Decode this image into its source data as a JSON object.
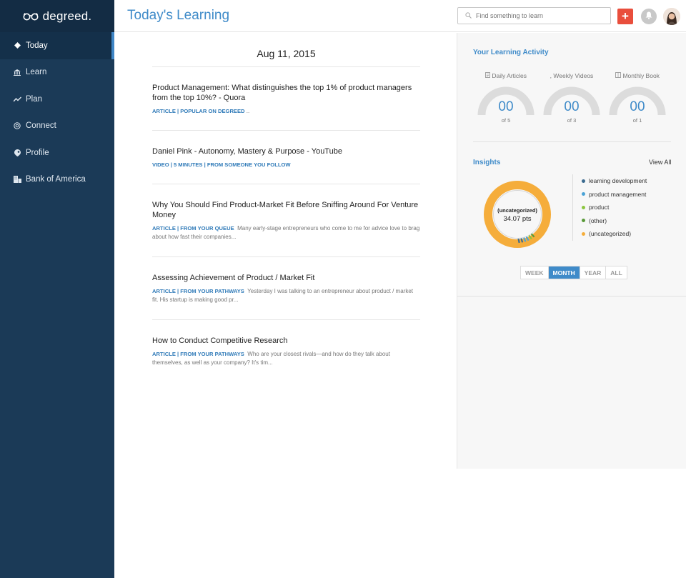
{
  "app": {
    "logo": "degreed."
  },
  "sidebar": {
    "items": [
      {
        "label": "Today",
        "icon": "diamond-icon",
        "active": true
      },
      {
        "label": "Learn",
        "icon": "bank-icon",
        "active": false
      },
      {
        "label": "Plan",
        "icon": "trend-icon",
        "active": false
      },
      {
        "label": "Connect",
        "icon": "at-icon",
        "active": false
      },
      {
        "label": "Profile",
        "icon": "profile-icon",
        "active": false
      },
      {
        "label": "Bank of America",
        "icon": "building-icon",
        "active": false
      }
    ]
  },
  "header": {
    "title": "Today's Learning",
    "search_placeholder": "Find something to learn",
    "add_label": "+"
  },
  "feed": {
    "date": "Aug 11, 2015",
    "items": [
      {
        "title": "Product Management: What distinguishes the top 1% of product managers from the top 10%? - Quora",
        "tags": "ARTICLE | POPULAR ON DEGREED",
        "snippet": " .."
      },
      {
        "title": "Daniel Pink - Autonomy, Mastery & Purpose - YouTube",
        "tags": "VIDEO | 5 MINUTES | FROM SOMEONE YOU FOLLOW",
        "snippet": ""
      },
      {
        "title": "Why You Should Find Product-Market Fit Before Sniffing Around For Venture Money",
        "tags": "ARTICLE | FROM YOUR QUEUE",
        "snippet": "Many early-stage entrepreneurs who come to me for advice love to brag about how fast their companies..."
      },
      {
        "title": "Assessing Achievement of Product / Market Fit",
        "tags": "ARTICLE | FROM YOUR PATHWAYS",
        "snippet": "Yesterday I was talking to an entrepreneur about product / market fit. His startup is making good pr..."
      },
      {
        "title": "How to Conduct Competitive Research",
        "tags": "ARTICLE | FROM YOUR PATHWAYS",
        "snippet": "Who are your closest rivals—and how do they talk about themselves, as well as your company? It's tim..."
      }
    ]
  },
  "activity": {
    "title": "Your Learning Activity",
    "gauges": [
      {
        "label": "Daily Articles",
        "icon": "document-icon",
        "value": "00",
        "of": "of 5",
        "fraction": 0
      },
      {
        "label": ", Weekly Videos",
        "icon": "",
        "value": "00",
        "of": "of 3",
        "fraction": 0
      },
      {
        "label": "Monthly Book",
        "icon": "book-icon",
        "value": "00",
        "of": "of 1",
        "fraction": 0
      }
    ]
  },
  "insights": {
    "title": "Insights",
    "view_all": "View All",
    "center_category": "(uncategorized)",
    "center_points": "34.07 pts",
    "legend": [
      {
        "label": "learning development",
        "color": "#3b6b8f"
      },
      {
        "label": "product management",
        "color": "#4aa3d6"
      },
      {
        "label": "product",
        "color": "#8cc63f"
      },
      {
        "label": "(other)",
        "color": "#5a9a3a"
      },
      {
        "label": "(uncategorized)",
        "color": "#f5ad3b"
      }
    ],
    "ranges": [
      {
        "label": "WEEK",
        "active": false
      },
      {
        "label": "MONTH",
        "active": true
      },
      {
        "label": "YEAR",
        "active": false
      },
      {
        "label": "ALL",
        "active": false
      }
    ]
  }
}
